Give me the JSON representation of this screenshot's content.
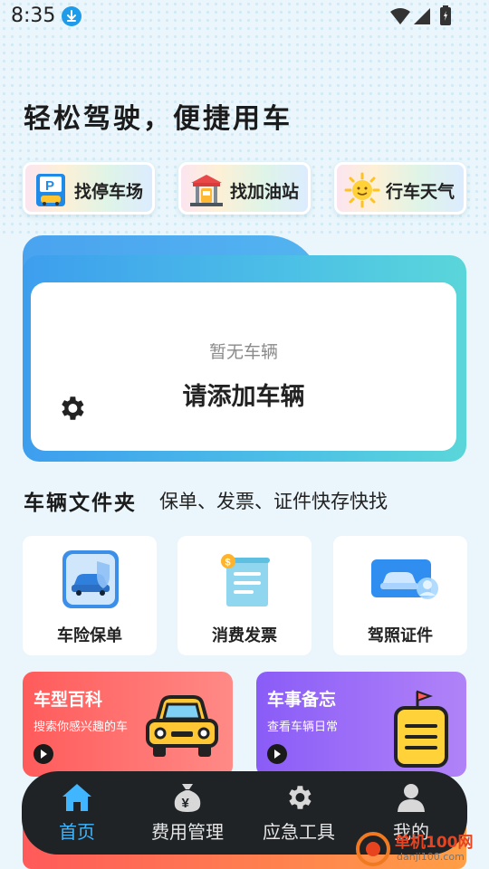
{
  "status_bar": {
    "time": "8:35"
  },
  "headline": "轻松驾驶，便捷用车",
  "quick_actions": [
    {
      "label": "找停车场",
      "icon": "parking-icon"
    },
    {
      "label": "找加油站",
      "icon": "gas-station-icon"
    },
    {
      "label": "行车天气",
      "icon": "sun-icon"
    }
  ],
  "vehicle_card": {
    "empty_text": "暂无车辆",
    "add_text": "请添加车辆",
    "settings_icon": "gear-icon"
  },
  "folder": {
    "title": "车辆文件夹",
    "subtitle": "保单、发票、证件快存快找",
    "items": [
      {
        "label": "车险保单",
        "icon": "insurance-car-icon"
      },
      {
        "label": "消费发票",
        "icon": "invoice-icon"
      },
      {
        "label": "驾照证件",
        "icon": "license-card-icon"
      }
    ]
  },
  "promos": [
    {
      "title": "车型百科",
      "subtitle": "搜索你感兴趣的车",
      "icon": "yellow-car-icon",
      "color": "#ff6a68"
    },
    {
      "title": "车事备忘",
      "subtitle": "查看车辆日常",
      "icon": "memo-note-icon",
      "color": "#9b6cf8"
    }
  ],
  "tabs": [
    {
      "label": "首页",
      "icon": "home-icon",
      "active": true
    },
    {
      "label": "费用管理",
      "icon": "money-bag-icon"
    },
    {
      "label": "应急工具",
      "icon": "gear-icon"
    },
    {
      "label": "我的",
      "icon": "user-icon"
    }
  ],
  "watermark": {
    "name": "单机100网",
    "domain": "danji100.com"
  },
  "colors": {
    "accent": "#3fb6ff",
    "tabbar": "#1f2326",
    "card_blue": "#3d9eee"
  }
}
